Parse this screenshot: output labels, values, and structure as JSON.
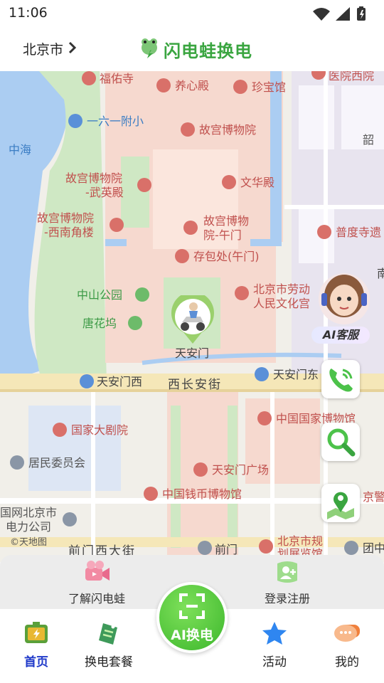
{
  "status": {
    "time": "11:06"
  },
  "header": {
    "city": "北京市",
    "brand": "闪电蛙换电"
  },
  "map": {
    "pois": [
      {
        "label": "福佑寺"
      },
      {
        "label": "养心殿"
      },
      {
        "label": "珍宝馆"
      },
      {
        "label": "医院西院"
      },
      {
        "label": "一六一附小"
      },
      {
        "label": "中海"
      },
      {
        "label": "故宫博物院"
      },
      {
        "label": "韶"
      },
      {
        "label": "故宫博物院"
      },
      {
        "label": "-武英殿"
      },
      {
        "label": "文华殿"
      },
      {
        "label": "故宫博物院"
      },
      {
        "label": "-西南角楼"
      },
      {
        "label": "故宫博物"
      },
      {
        "label": "院-午门"
      },
      {
        "label": "普度寺遗"
      },
      {
        "label": "存包处(午门)"
      },
      {
        "label": "中山公园"
      },
      {
        "label": "北京市劳动"
      },
      {
        "label": "人民文化宫"
      },
      {
        "label": "唐花坞"
      },
      {
        "label": "天安门"
      },
      {
        "label": "天安门西"
      },
      {
        "label": "天安门东"
      },
      {
        "label": "中国国家博物馆"
      },
      {
        "label": "国家大剧院"
      },
      {
        "label": "居民委员会"
      },
      {
        "label": "天安门广场"
      },
      {
        "label": "中国钱币博物馆"
      },
      {
        "label": "国网北京市"
      },
      {
        "label": "电力公司"
      },
      {
        "label": "©天地图"
      },
      {
        "label": "前门"
      },
      {
        "label": "北京市规"
      },
      {
        "label": "划展览馆"
      },
      {
        "label": "团中"
      },
      {
        "label": "京警"
      },
      {
        "label": "南"
      },
      {
        "label": "西长安街"
      },
      {
        "label": "前门西大街"
      }
    ]
  },
  "ai_service": {
    "label": "AI客服"
  },
  "quick_actions": [
    {
      "label": "了解闪电蛙",
      "icon": "video-camera-icon"
    },
    {
      "label": "登录注册",
      "icon": "user-add-icon"
    }
  ],
  "center_button": {
    "label": "AI换电"
  },
  "tabs": [
    {
      "label": "首页",
      "icon": "battery-home-icon",
      "active": true
    },
    {
      "label": "换电套餐",
      "icon": "package-tag-icon",
      "active": false
    },
    {
      "label": "活动",
      "icon": "star-icon",
      "active": false
    },
    {
      "label": "我的",
      "icon": "chat-bubble-icon",
      "active": false
    }
  ],
  "colors": {
    "brand_green": "#3aa540",
    "active_tab": "#1f39c9",
    "poi_red": "#c0504d"
  }
}
